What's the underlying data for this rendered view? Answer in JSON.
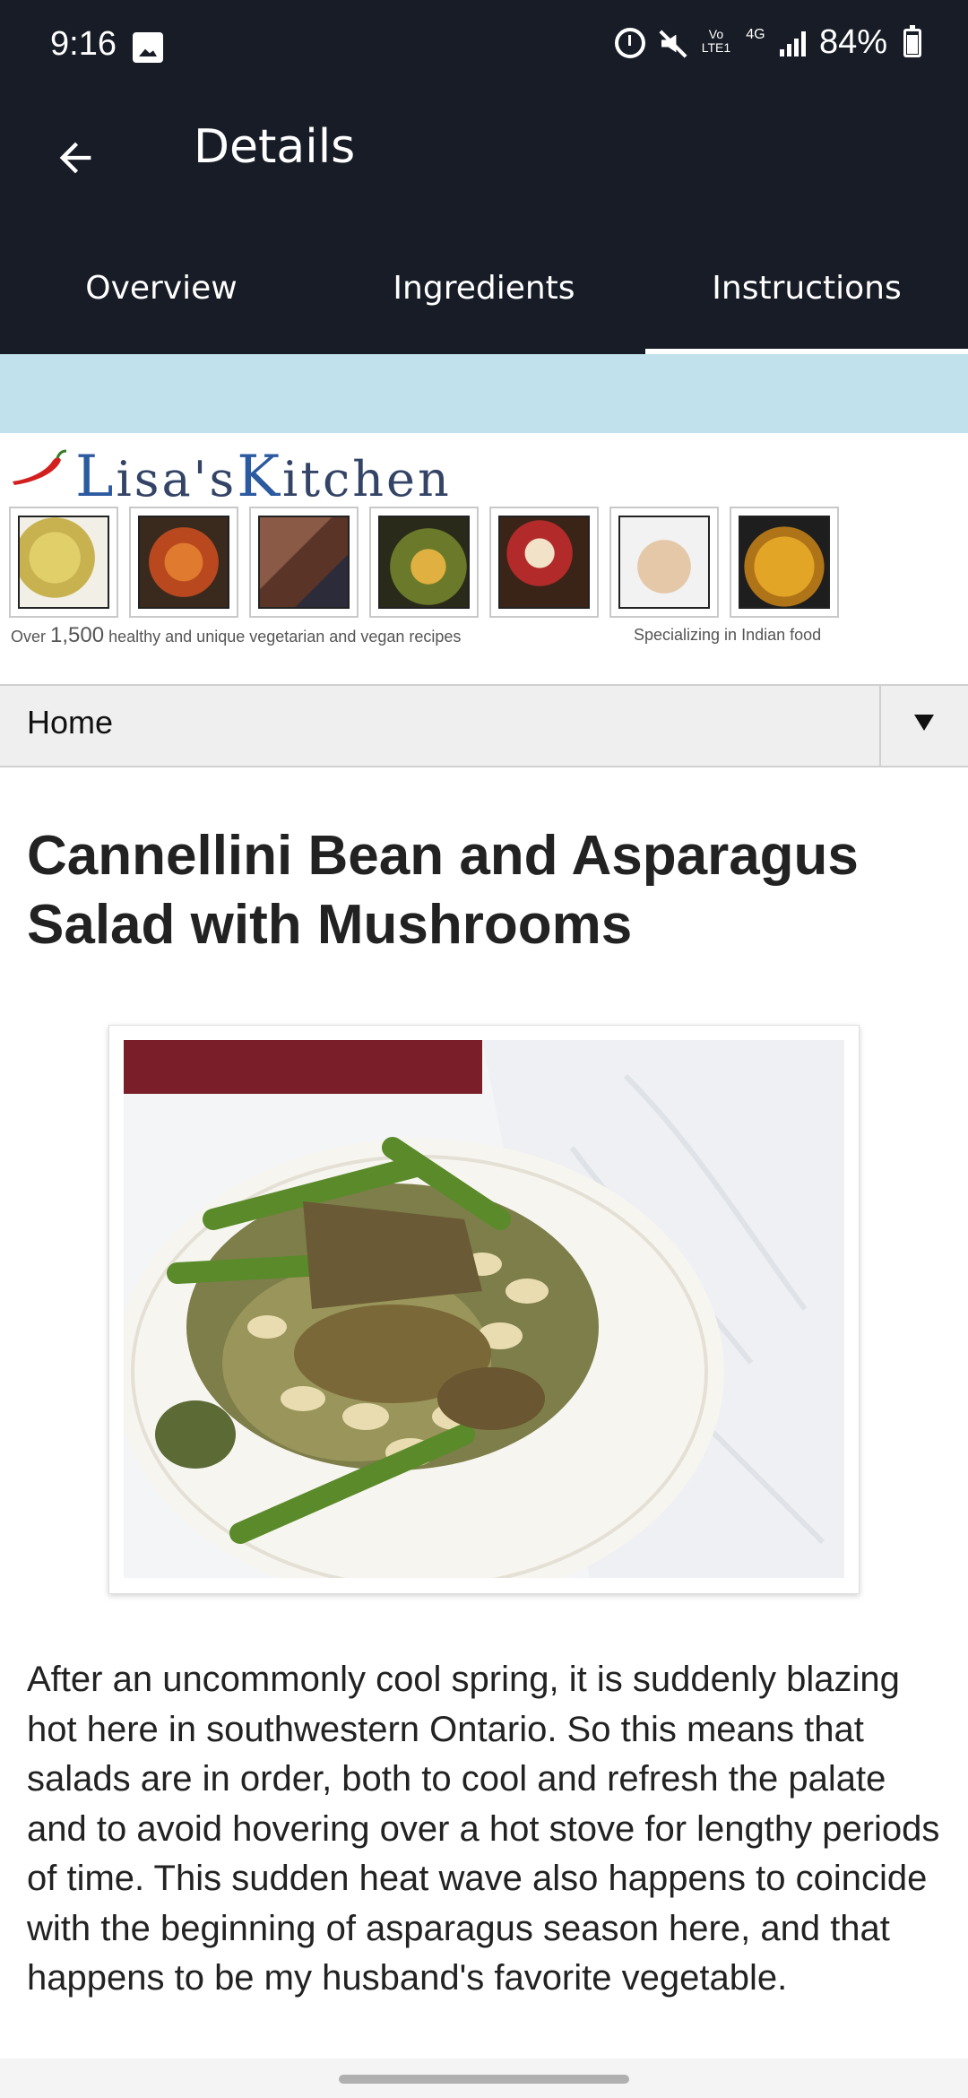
{
  "status_bar": {
    "time": "9:16",
    "volte": "Vo LTE1",
    "network": "4G",
    "battery": "84%"
  },
  "app_bar": {
    "title": "Details",
    "tabs": [
      {
        "label": "Overview",
        "active": false
      },
      {
        "label": "Ingredients",
        "active": false
      },
      {
        "label": "Instructions",
        "active": true
      }
    ]
  },
  "banner": {
    "logo": "Lisa's Kitchen",
    "logo_L": "L",
    "logo_mid": "isa's",
    "logo_K": "K",
    "logo_end": "itchen",
    "tagline_prefix": "Over",
    "tagline_count": "1,500",
    "tagline_suffix": "healthy and unique vegetarian and vegan recipes",
    "tagline_right": "Specializing in Indian food",
    "thumb_colors": [
      "#d8c46a",
      "#c5632a",
      "#7a4a3a",
      "#6b7a2a",
      "#b22a2a",
      "#d9b89a",
      "#d49a22"
    ]
  },
  "nav": {
    "selected": "Home"
  },
  "recipe": {
    "title": "Cannellini Bean and Asparagus Salad with Mushrooms",
    "intro": "After an uncommonly cool spring, it is suddenly blazing hot here in southwestern Ontario. So this means that salads are in order, both to cool and refresh the palate and to avoid hovering over a hot stove for lengthy periods of time. This sudden heat wave also happens to coincide with the beginning of asparagus season here, and that happens to be my husband's favorite vegetable."
  },
  "colors": {
    "app_bar_bg": "#171c26",
    "ad_band_bg": "#c1e2ec",
    "nav_bg": "#efefef"
  }
}
